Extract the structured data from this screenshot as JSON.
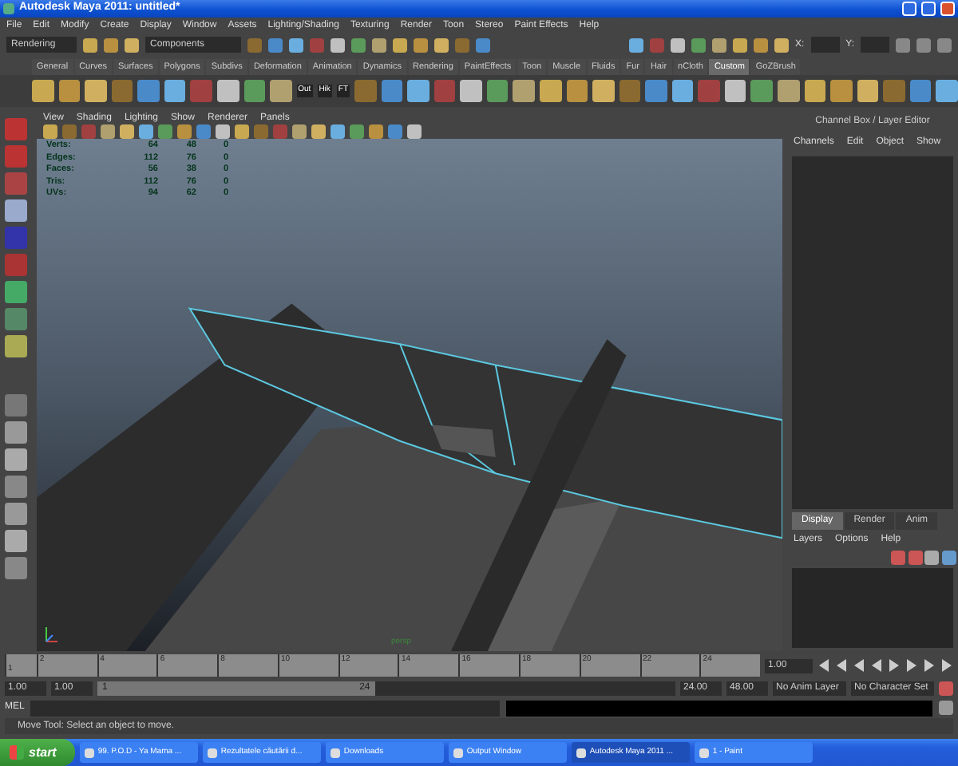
{
  "window": {
    "title": "Autodesk Maya 2011: untitled*"
  },
  "menu_bar": [
    "File",
    "Edit",
    "Modify",
    "Create",
    "Display",
    "Window",
    "Assets",
    "Lighting/Shading",
    "Texturing",
    "Render",
    "Toon",
    "Stereo",
    "Paint Effects",
    "Help"
  ],
  "status_line": {
    "menu_set": "Rendering",
    "selection_mode": "Components",
    "x_label": "X:",
    "y_label": "Y:"
  },
  "shelf": {
    "tabs": [
      {
        "label": "General",
        "selected": false
      },
      {
        "label": "Curves",
        "selected": false
      },
      {
        "label": "Surfaces",
        "selected": false
      },
      {
        "label": "Polygons",
        "selected": false
      },
      {
        "label": "Subdivs",
        "selected": false
      },
      {
        "label": "Deformation",
        "selected": false
      },
      {
        "label": "Animation",
        "selected": false
      },
      {
        "label": "Dynamics",
        "selected": false
      },
      {
        "label": "Rendering",
        "selected": false
      },
      {
        "label": "PaintEffects",
        "selected": false
      },
      {
        "label": "Toon",
        "selected": false
      },
      {
        "label": "Muscle",
        "selected": false
      },
      {
        "label": "Fluids",
        "selected": false
      },
      {
        "label": "Fur",
        "selected": false
      },
      {
        "label": "Hair",
        "selected": false
      },
      {
        "label": "nCloth",
        "selected": false
      },
      {
        "label": "Custom",
        "selected": true
      },
      {
        "label": "GoZBrush",
        "selected": false
      }
    ],
    "icon_captions": [
      "Out",
      "Hik",
      "FT"
    ]
  },
  "viewport": {
    "menu": [
      "View",
      "Shading",
      "Lighting",
      "Show",
      "Renderer",
      "Panels"
    ],
    "hud": [
      {
        "label": "Verts:",
        "values": [
          "64",
          "48",
          "0"
        ]
      },
      {
        "label": "Edges:",
        "values": [
          "112",
          "76",
          "0"
        ]
      },
      {
        "label": "Faces:",
        "values": [
          "56",
          "38",
          "0"
        ]
      },
      {
        "label": "Tris:",
        "values": [
          "112",
          "76",
          "0"
        ]
      },
      {
        "label": "UVs:",
        "values": [
          "94",
          "62",
          "0"
        ]
      }
    ],
    "camera": "persp"
  },
  "channel_box": {
    "title": "Channel Box / Layer Editor",
    "menu": [
      "Channels",
      "Edit",
      "Object",
      "Show"
    ]
  },
  "layer_editor": {
    "tabs": [
      {
        "label": "Display",
        "selected": true
      },
      {
        "label": "Render",
        "selected": false
      },
      {
        "label": "Anim",
        "selected": false
      }
    ],
    "menu": [
      "Layers",
      "Options",
      "Help"
    ]
  },
  "time_slider": {
    "current_frame": "1",
    "ticks": [
      "2",
      "4",
      "6",
      "8",
      "10",
      "12",
      "14",
      "16",
      "18",
      "20",
      "22",
      "24"
    ],
    "current_time": "1.00"
  },
  "range_slider": {
    "level": 0.48,
    "start": "1.00",
    "playback_start": "1.00",
    "range_start": "1",
    "range_end": "24",
    "playback_end": "24.00",
    "end": "48.00",
    "anim_layer": "No Anim Layer",
    "character_set": "No Character Set"
  },
  "command_line": {
    "label": "MEL"
  },
  "help_line": "Move Tool: Select an object to move.",
  "taskbar": {
    "start": "start",
    "items": [
      {
        "label": "99. P.O.D - Ya Mama ...",
        "selected": false
      },
      {
        "label": "Rezultatele căutării d...",
        "selected": false
      },
      {
        "label": "Downloads",
        "selected": false
      },
      {
        "label": "Output Window",
        "selected": false
      },
      {
        "label": "Autodesk Maya 2011 ...",
        "selected": true
      },
      {
        "label": "1 - Paint",
        "selected": false
      }
    ]
  }
}
